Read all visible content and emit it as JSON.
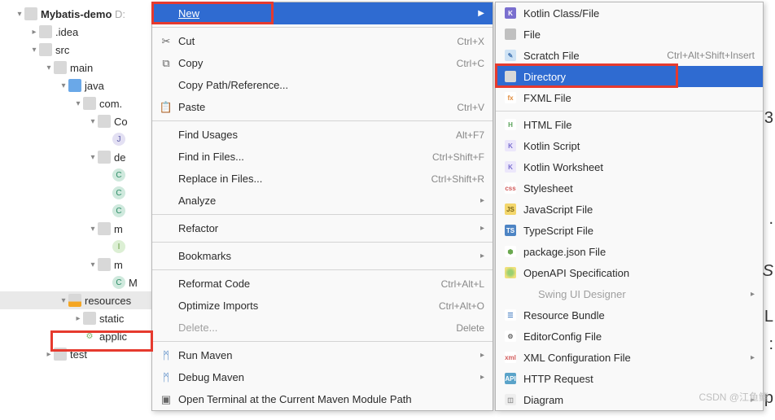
{
  "tree": {
    "root": "Mybatis-demo",
    "root_suffix": "D:",
    "items": [
      ".idea",
      "src",
      "main",
      "java",
      "com.",
      "Co",
      "de",
      "m",
      "m",
      "M",
      "resources",
      "static",
      "applic",
      "test"
    ]
  },
  "menu1": {
    "new": "New",
    "cut": "Cut",
    "cut_k": "Ctrl+X",
    "copy": "Copy",
    "copy_k": "Ctrl+C",
    "copypath": "Copy Path/Reference...",
    "paste": "Paste",
    "paste_k": "Ctrl+V",
    "findu": "Find Usages",
    "findu_k": "Alt+F7",
    "findf": "Find in Files...",
    "findf_k": "Ctrl+Shift+F",
    "replf": "Replace in Files...",
    "replf_k": "Ctrl+Shift+R",
    "analyze": "Analyze",
    "refactor": "Refactor",
    "bookmarks": "Bookmarks",
    "reformat": "Reformat Code",
    "reformat_k": "Ctrl+Alt+L",
    "optim": "Optimize Imports",
    "optim_k": "Ctrl+Alt+O",
    "delete": "Delete...",
    "delete_k": "Delete",
    "runmvn": "Run Maven",
    "dbgmvn": "Debug Maven",
    "term": "Open Terminal at the Current Maven Module Path"
  },
  "menu2": {
    "kclass": "Kotlin Class/File",
    "file": "File",
    "scratch": "Scratch File",
    "scratch_k": "Ctrl+Alt+Shift+Insert",
    "dir": "Directory",
    "fxml": "FXML File",
    "html": "HTML File",
    "kscript": "Kotlin Script",
    "kws": "Kotlin Worksheet",
    "css": "Stylesheet",
    "js": "JavaScript File",
    "ts": "TypeScript File",
    "pkg": "package.json File",
    "openapi": "OpenAPI Specification",
    "swing": "Swing UI Designer",
    "rb": "Resource Bundle",
    "ec": "EditorConfig File",
    "xml": "XML Configuration File",
    "http": "HTTP Request",
    "diag": "Diagram"
  },
  "watermark": "CSDN @江鱼鳍",
  "side": [
    "3",
    ".",
    "S",
    "L",
    ":",
    "p"
  ]
}
